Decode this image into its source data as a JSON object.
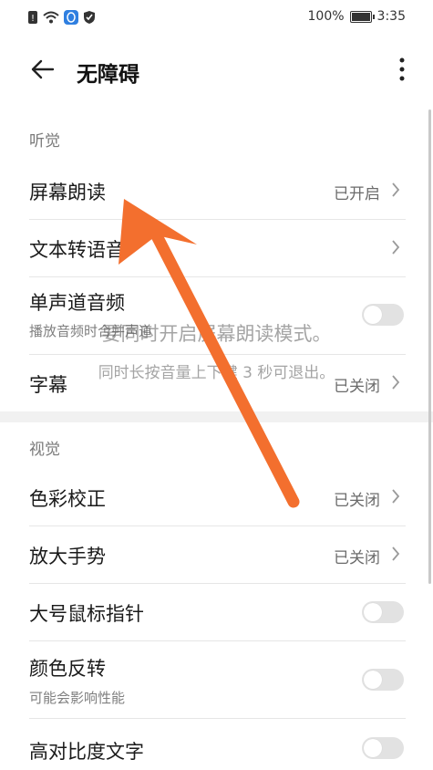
{
  "status_bar": {
    "icons": [
      "data-saver-icon",
      "wifi-icon",
      "shield-blue-icon",
      "shield-check-icon"
    ],
    "battery_text": "100%",
    "battery_level": 1.0,
    "time": "3:35"
  },
  "app_bar": {
    "title": "无障碍",
    "back_icon": "arrow-left-icon",
    "more_icon": "more-vertical-icon"
  },
  "sections": {
    "hearing": {
      "label": "听觉",
      "items": [
        {
          "title": "屏幕朗读",
          "value": "已开启"
        },
        {
          "title": "文本转语音",
          "value": ""
        },
        {
          "title": "单声道音频",
          "subtitle": "播放音频时合并声道",
          "toggle": false
        },
        {
          "title": "字幕",
          "value": "已关闭"
        }
      ]
    },
    "vision": {
      "label": "视觉",
      "items": [
        {
          "title": "色彩校正",
          "value": "已关闭"
        },
        {
          "title": "放大手势",
          "value": "已关闭"
        },
        {
          "title": "大号鼠标指针",
          "toggle": false
        },
        {
          "title": "颜色反转",
          "subtitle": "可能会影响性能",
          "toggle": false
        },
        {
          "title": "高对比度文字",
          "toggle": false
        }
      ]
    }
  },
  "overlay_hint": {
    "line1": "要同时开启屏幕朗读模式。",
    "line2": "同时长按音量上下键 3 秒可退出。"
  },
  "colors": {
    "arrow": "#f36f2e",
    "toggle_off": "#e2e2e2",
    "secondary_text": "#7a7a7a"
  }
}
